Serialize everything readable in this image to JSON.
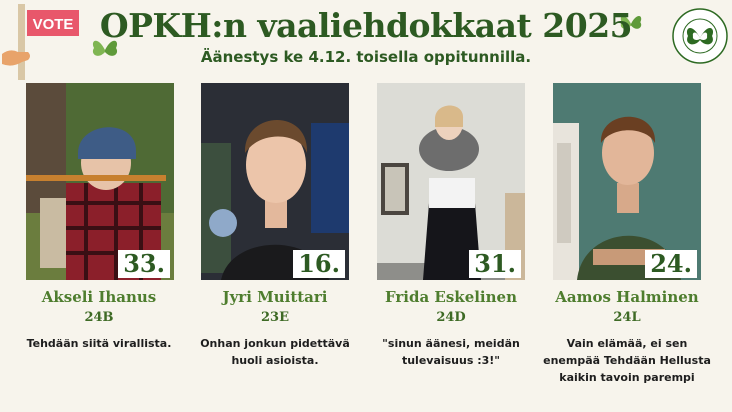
{
  "header": {
    "title": "OPKH:n vaaliehdokkaat 2025",
    "subtitle": "Äänestys ke 4.12. toisella oppitunnilla."
  },
  "vote_sign": {
    "label": "VOTE",
    "color": "#e8576b"
  },
  "logo": {
    "ring_text": "HELSINGIN LUONNONTIEDELUKIO · HELLU · OPKH ·",
    "color": "#2d6a22"
  },
  "colors": {
    "title": "#2d5a22",
    "name": "#4e7d2e",
    "background": "#f7f4ec"
  },
  "candidates": [
    {
      "number": "33.",
      "name": "Akseli Ihanus",
      "class": "24B",
      "quote": "Tehdään siitä virallista."
    },
    {
      "number": "16.",
      "name": "Jyri Muittari",
      "class": "23E",
      "quote": "Onhan jonkun pidettävä huoli asioista."
    },
    {
      "number": "31.",
      "name": "Frida Eskelinen",
      "class": "24D",
      "quote": "\"sinun äänesi, meidän tulevaisuus :3!\""
    },
    {
      "number": "24.",
      "name": "Aamos Halminen",
      "class": "24L",
      "quote": "Vain elämää, ei sen enempää Tehdään Hellusta kaikin tavoin parempi"
    }
  ]
}
